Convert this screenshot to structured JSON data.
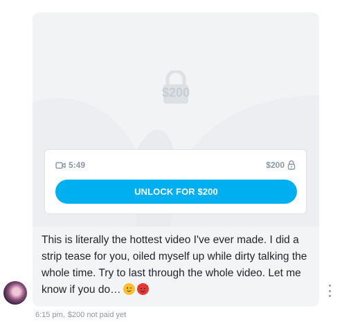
{
  "message": {
    "locked_price": "$200",
    "video_duration": "5:49",
    "price": "$200",
    "unlock_button": "UNLOCK FOR $200",
    "text": "This is literally the hottest video I've ever made. I did a strip tease for you, oiled myself up while dirty talking the whole time. Try to last through the whole video. Let me know if you do…",
    "emojis": [
      "winking-face",
      "smiling-devil-face"
    ]
  },
  "meta": {
    "time": "6:15 pm,",
    "status": "$200 not paid yet"
  },
  "colors": {
    "accent": "#00aff0",
    "muted_text": "#8a96a3",
    "card_bg": "#f3f4f6"
  }
}
